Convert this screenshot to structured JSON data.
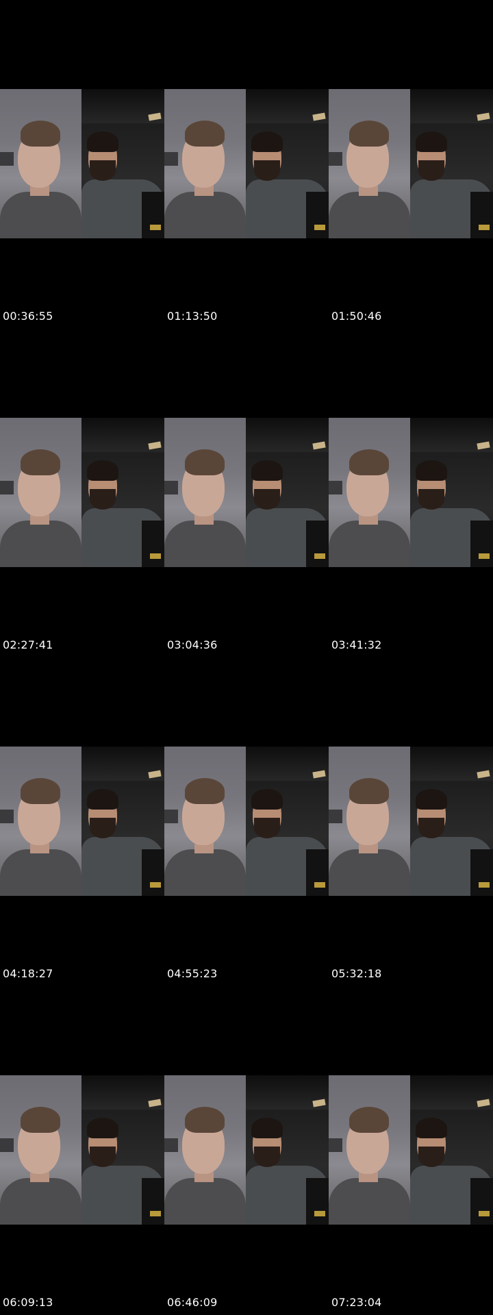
{
  "timestamps": [
    "00:36:55",
    "01:13:50",
    "01:50:46",
    "02:27:41",
    "03:04:36",
    "03:41:32",
    "04:18:27",
    "04:55:23",
    "05:32:18",
    "06:09:13",
    "06:46:09",
    "07:23:04"
  ],
  "colors": {
    "background": "#000000",
    "timestamp_text": "#ffffff"
  }
}
